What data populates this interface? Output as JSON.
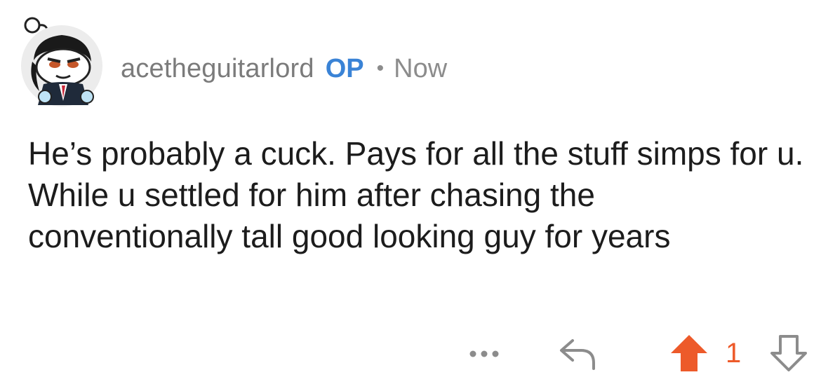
{
  "comment": {
    "author": "acetheguitarlord",
    "op_label": "OP",
    "separator": "•",
    "timestamp": "Now",
    "body": "He’s probably a cuck. Pays for all the stuff simps for u. While u settled for him after chasing the conventionally tall good looking guy for years",
    "avatar_icon": "snoo-avatar-icon"
  },
  "actions": {
    "more_icon": "more-horizontal-icon",
    "reply_icon": "reply-arrow-icon",
    "upvote_icon": "upvote-arrow-icon",
    "vote_count": "1",
    "downvote_icon": "downvote-arrow-icon"
  },
  "colors": {
    "op_badge": "#3a83d6",
    "upvote_active": "#ed5a2a",
    "username": "#7b7b7b",
    "body_text": "#1c1c1c",
    "icon_gray": "#8c8c8c"
  }
}
